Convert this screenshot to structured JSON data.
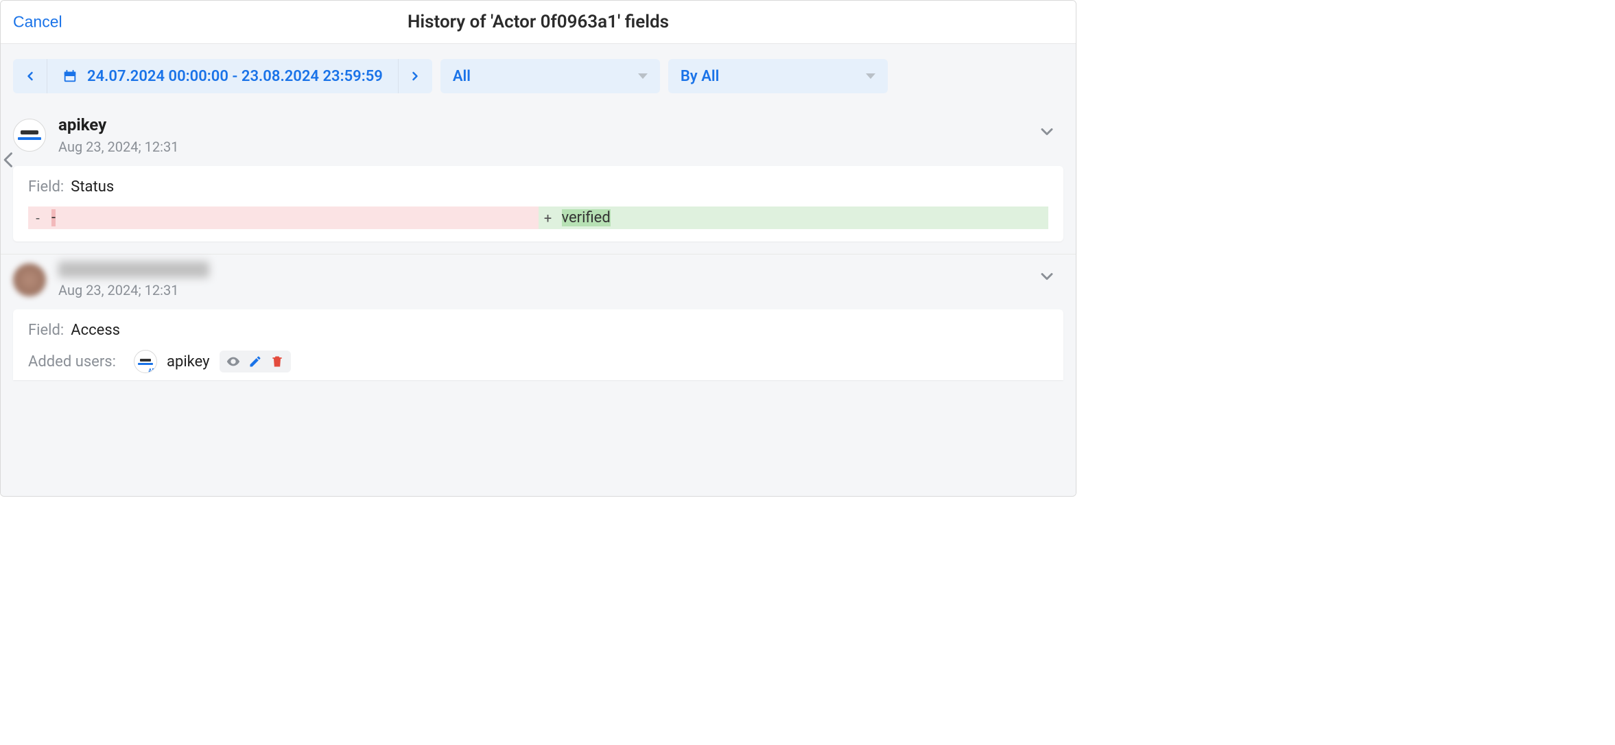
{
  "header": {
    "cancel": "Cancel",
    "title": "History of 'Actor 0f0963a1' fields"
  },
  "filters": {
    "date_range": "24.07.2024 00:00:00 - 23.08.2024 23:59:59",
    "field_filter": "All",
    "by_filter": "By All"
  },
  "entries": [
    {
      "user": "apikey",
      "timestamp": "Aug 23, 2024; 12:31",
      "card": {
        "field_label": "Field:",
        "field_name": "Status",
        "diff_del_sign": "-",
        "diff_del_text": "-",
        "diff_add_sign": "+",
        "diff_add_text": "verified"
      }
    },
    {
      "user_hidden": true,
      "timestamp": "Aug 23, 2024; 12:31",
      "card": {
        "field_label": "Field:",
        "field_name": "Access",
        "added_label": "Added users:",
        "added_user": "apikey"
      }
    }
  ],
  "icons": {
    "eye": "eye-icon",
    "pencil": "pencil-icon",
    "trash": "trash-icon"
  }
}
